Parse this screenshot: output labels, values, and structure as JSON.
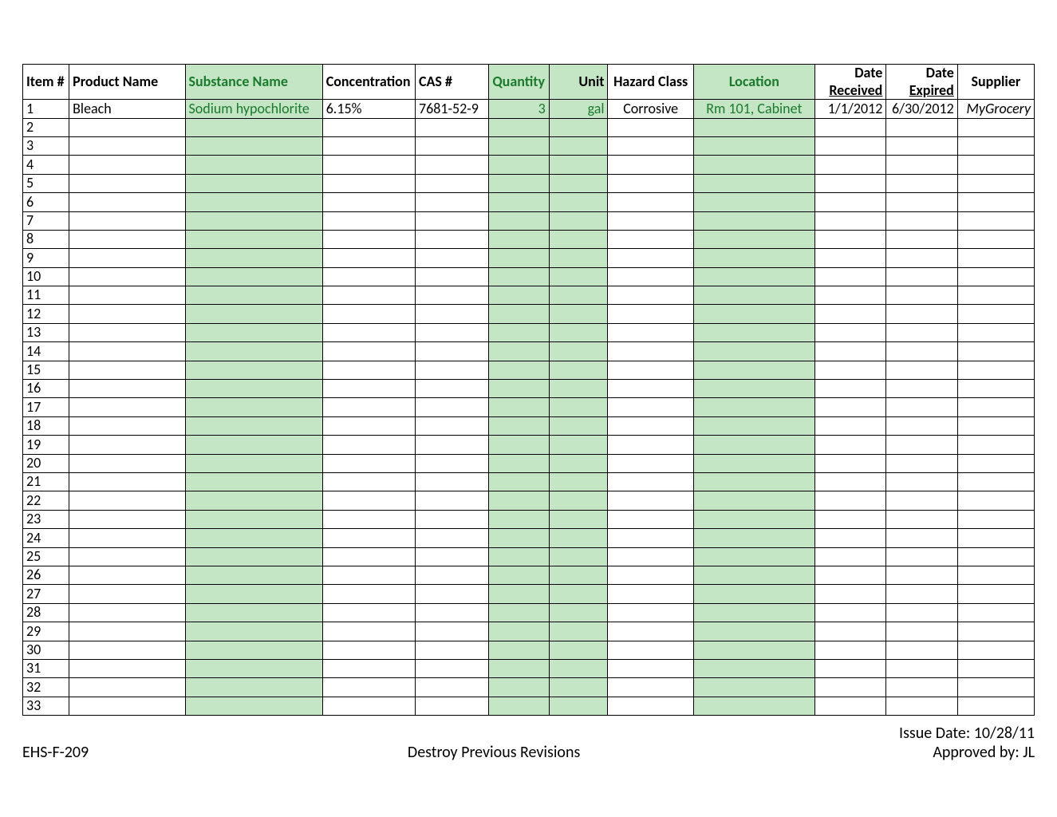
{
  "headers": {
    "item": {
      "label": "Item #",
      "align": "al",
      "green": false
    },
    "product": {
      "label": "Product Name",
      "align": "al",
      "green": false
    },
    "substance": {
      "label": "Substance Name",
      "align": "al",
      "green": true
    },
    "concentration": {
      "label": "Concentration",
      "align": "al",
      "green": false
    },
    "cas": {
      "label": "CAS #",
      "align": "al",
      "green": false
    },
    "quantity": {
      "label": "Quantity",
      "align": "ac",
      "green": true
    },
    "unit": {
      "label": "Unit",
      "align": "ar",
      "green": false
    },
    "hazard": {
      "label": "Hazard Class",
      "align": "ac",
      "green": false
    },
    "location": {
      "label": "Location",
      "align": "ac",
      "green": true
    },
    "date_received": {
      "label1": "Date",
      "label2": "Received",
      "align": "ar",
      "green": false
    },
    "date_expired": {
      "label1": "Date",
      "label2": "Expired",
      "align": "ar",
      "green": false
    },
    "supplier": {
      "label": "Supplier",
      "align": "ac",
      "green": false
    }
  },
  "row1": {
    "item": "1",
    "product": "Bleach",
    "substance": "Sodium hypochlorite",
    "concentration": "6.15%",
    "cas": "7681-52-9",
    "quantity": "3",
    "unit": "gal",
    "hazard": "Corrosive",
    "location": "Rm 101, Cabinet",
    "date_received": "1/1/2012",
    "date_expired": "6/30/2012",
    "supplier": "MyGrocery"
  },
  "empty_rows": [
    "2",
    "3",
    "4",
    "5",
    "6",
    "7",
    "8",
    "9",
    "10",
    "11",
    "12",
    "13",
    "14",
    "15",
    "16",
    "17",
    "18",
    "19",
    "20",
    "21",
    "22",
    "23",
    "24",
    "25",
    "26",
    "27",
    "28",
    "29",
    "30",
    "31",
    "32",
    "33"
  ],
  "green_cols": [
    2,
    5,
    6,
    8
  ],
  "footer": {
    "left": "EHS-F-209",
    "center": "Destroy Previous Revisions",
    "right1": "Issue Date: 10/28/11",
    "right2": "Approved by: JL"
  }
}
